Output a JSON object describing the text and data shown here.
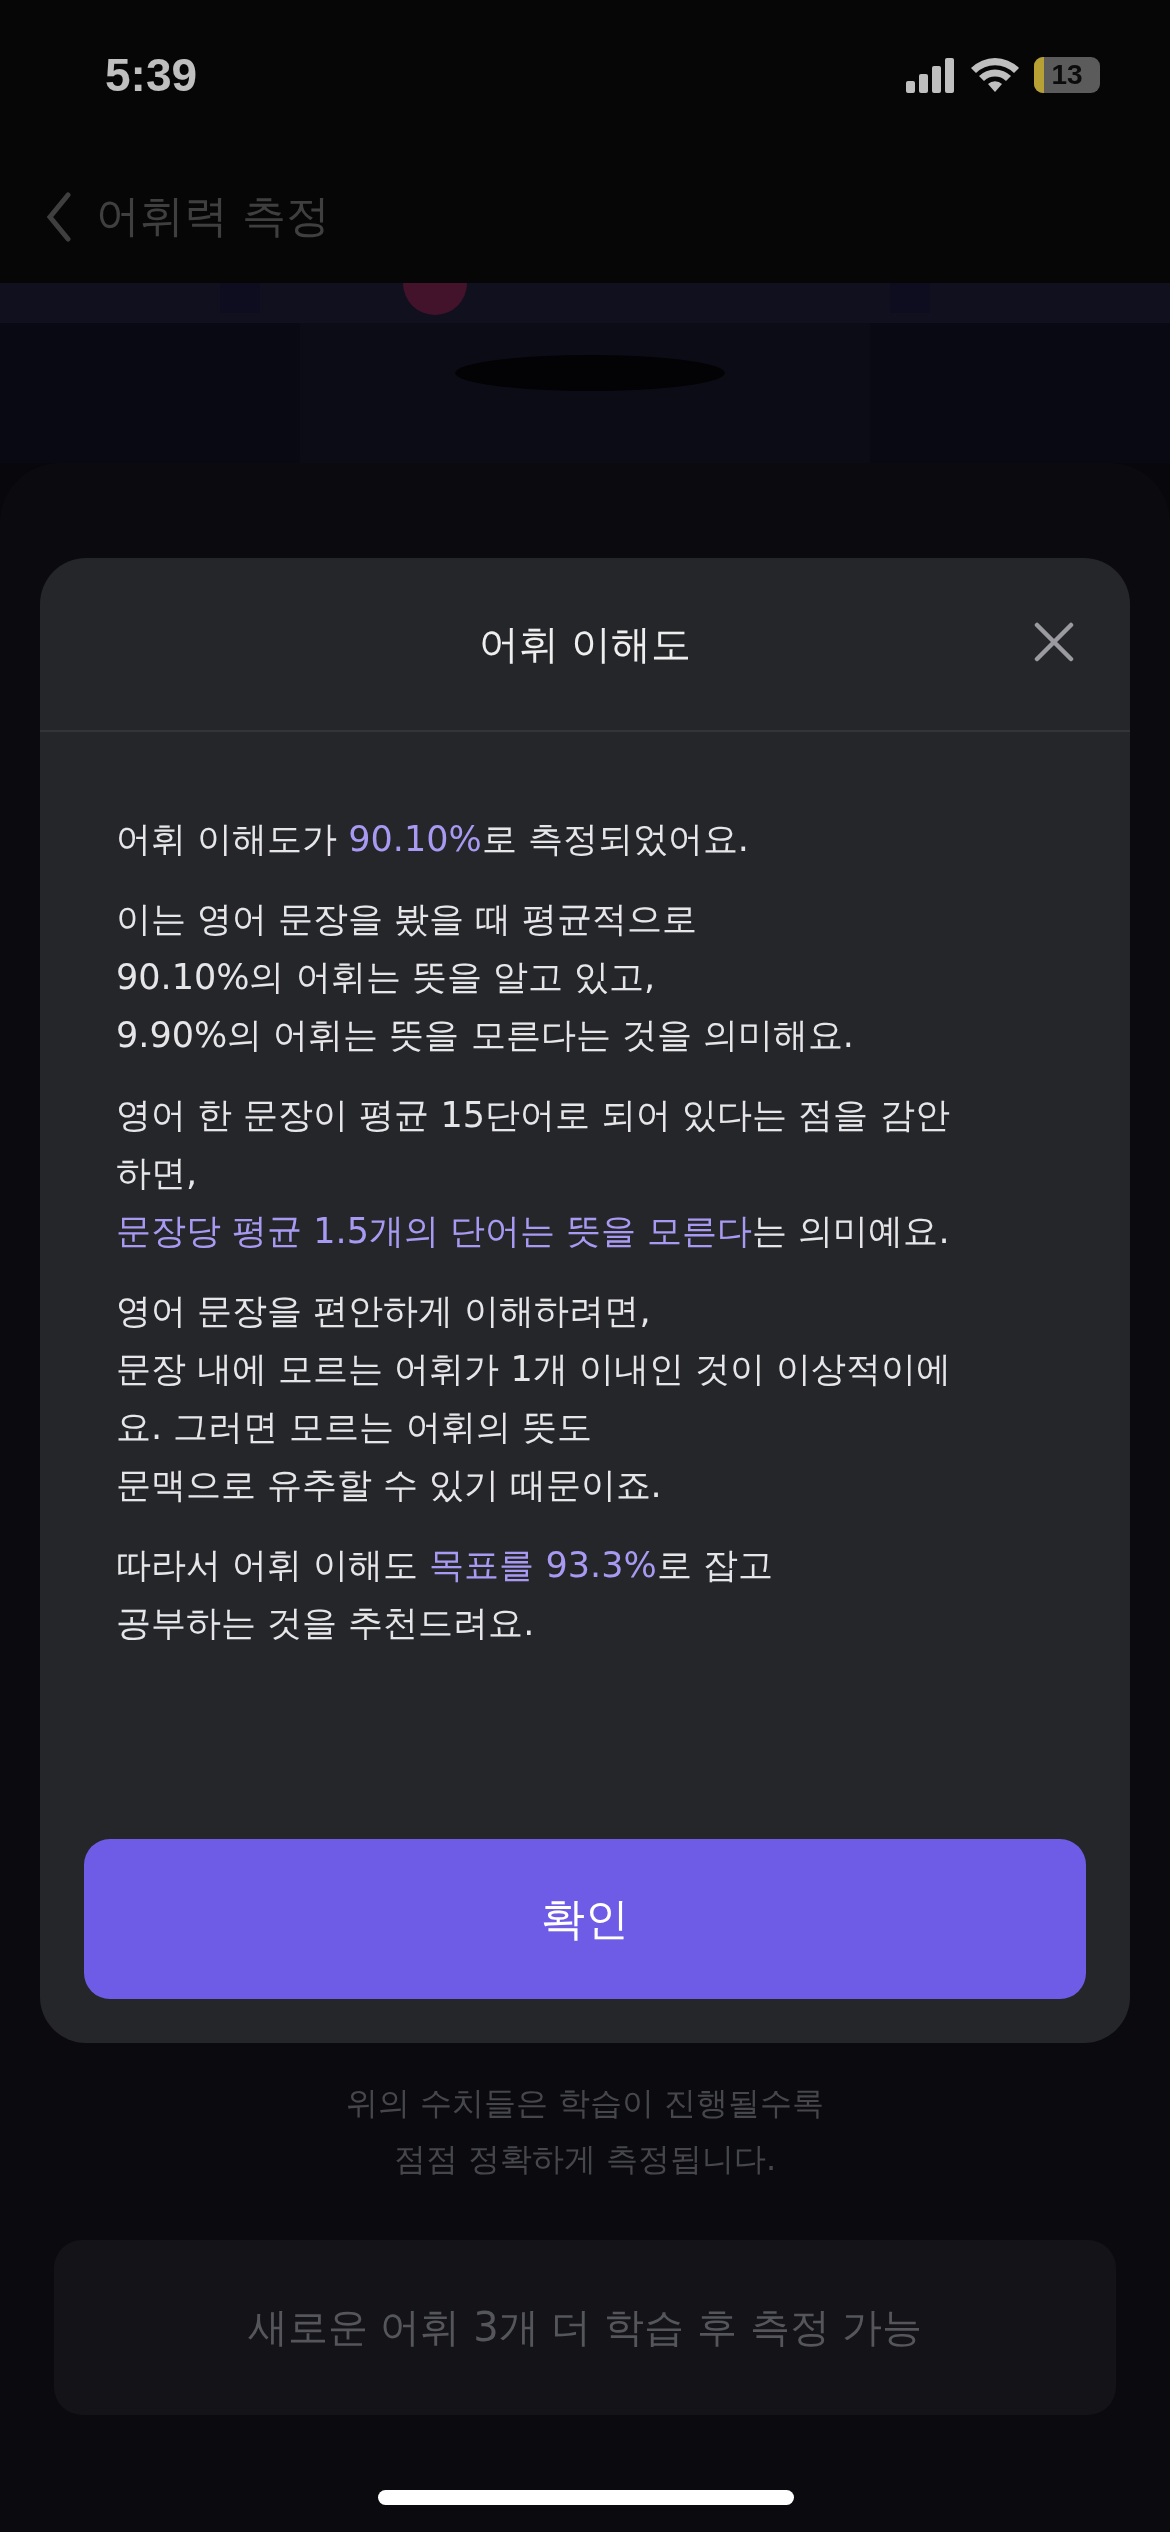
{
  "status_bar": {
    "time": "5:39",
    "battery": "13"
  },
  "nav": {
    "title": "어휘력 측정"
  },
  "modal": {
    "title": "어휘 이해도",
    "paragraphs": [
      [
        [
          {
            "text": "어휘 이해도가 ",
            "highlight": false
          },
          {
            "text": "90.10%",
            "highlight": true
          },
          {
            "text": "로 측정되었어요.",
            "highlight": false
          }
        ]
      ],
      [
        [
          {
            "text": "이는 영어 문장을 봤을 때 평균적으로",
            "highlight": false
          }
        ],
        [
          {
            "text": "90.10%의 어휘는 뜻을 알고 있고,",
            "highlight": false
          }
        ],
        [
          {
            "text": "9.90%의 어휘는 뜻을 모른다는 것을 의미해요.",
            "highlight": false
          }
        ]
      ],
      [
        [
          {
            "text": "영어 한 문장이 평균 15단어로 되어 있다는 점을 감안",
            "highlight": false
          }
        ],
        [
          {
            "text": "하면,",
            "highlight": false
          }
        ],
        [
          {
            "text": "문장당 평균 1.5개의 단어는 뜻을 모른다",
            "highlight": true
          },
          {
            "text": "는 의미예요.",
            "highlight": false
          }
        ]
      ],
      [
        [
          {
            "text": "영어 문장을 편안하게 이해하려면,",
            "highlight": false
          }
        ],
        [
          {
            "text": "문장 내에 모르는 어휘가 1개 이내인 것이 이상적이에",
            "highlight": false
          }
        ],
        [
          {
            "text": "요. 그러면 모르는 어휘의 뜻도",
            "highlight": false
          }
        ],
        [
          {
            "text": "문맥으로 유추할 수 있기 때문이죠.",
            "highlight": false
          }
        ]
      ],
      [
        [
          {
            "text": "따라서 어휘 이해도 ",
            "highlight": false
          },
          {
            "text": "목표를 93.3%",
            "highlight": true
          },
          {
            "text": "로 잡고",
            "highlight": false
          }
        ],
        [
          {
            "text": "공부하는 것을 추천드려요.",
            "highlight": false
          }
        ]
      ]
    ],
    "confirm": "확인"
  },
  "footer_note": [
    "위의 수치들은 학습이 진행될수록",
    "점점 정확하게 측정됩니다."
  ],
  "action": {
    "label": "새로운 어휘 3개 더 학습 후 측정 가능",
    "disabled": true
  }
}
